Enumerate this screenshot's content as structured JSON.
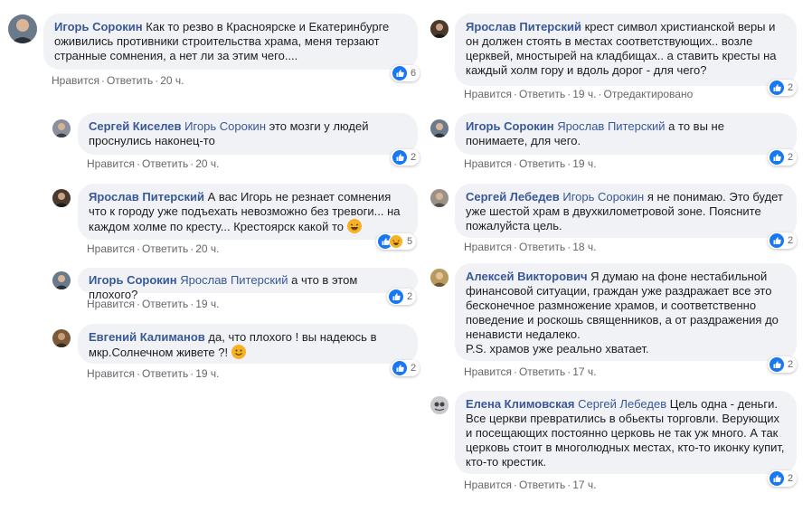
{
  "actions": {
    "like": "Нравится",
    "reply": "Ответить",
    "edited": "Отредактировано"
  },
  "left": [
    {
      "author": "Игорь Сорокин",
      "mention": "",
      "text": "Как то резво в Красноярске и Екатеринбурге оживились противники строительства храма, меня терзают странные сомнения, а нет ли за этим чего....",
      "time": "20 ч.",
      "reactions": "6"
    },
    {
      "author": "Сергей Киселев",
      "mention": "Игорь Сорокин",
      "text": "это мозги у людей проснулись наконец-то",
      "time": "20 ч.",
      "reactions": "2"
    },
    {
      "author": "Ярослав Питерский",
      "mention": "",
      "text": "А вас Игорь не резнает сомнения что к городу уже подъехать невозможно без тревоги... на каждом холме по кресту... Крестоярск какой то",
      "time": "20 ч.",
      "reactions": "5"
    },
    {
      "author": "Игорь Сорокин",
      "mention": "Ярослав Питерский",
      "text": "а что в этом плохого?",
      "time": "19 ч.",
      "reactions": "2"
    },
    {
      "author": "Евгений Калиманов",
      "mention": "",
      "text": "да, что плохого ! вы надеюсь в мкр.Солнечном живете ?!",
      "time": "19 ч.",
      "reactions": "2"
    }
  ],
  "right": [
    {
      "author": "Ярослав Питерский",
      "mention": "",
      "text": "крест символ христианской веры и он должен стоять в местах соответствующих.. возле церквей, мноcтырей на кладбищах.. а ставить кресты на каждый холм гору и вдоль дорог - для чего?",
      "time": "19 ч.",
      "reactions": "2"
    },
    {
      "author": "Игорь Сорокин",
      "mention": "Ярослав Питерский",
      "text": "а то вы не понимаете, для чего.",
      "time": "19 ч.",
      "reactions": "2"
    },
    {
      "author": "Сергей Лебедев",
      "mention": "Игорь Сорокин",
      "text": "я не понимаю. Это будет уже шестой храм в двухкилометровой зоне. Поясните пожалуйста цель.",
      "time": "18 ч.",
      "reactions": "2"
    },
    {
      "author": "Алексей Викторович",
      "mention": "",
      "text": "Я думаю на фоне нестабильной финансовой ситуации, граждан уже раздражает все это бесконечное размножение храмов, и соответственно поведение и роскошь священников, а от раздражения до ненависти недалеко.",
      "text2": "P.S. храмов уже реально хватает.",
      "time": "17 ч.",
      "reactions": "2"
    },
    {
      "author": "Елена Климовская",
      "mention": "Сергей Лебедев",
      "text": "Цель одна - деньги. Все церкви превратились в обьекты торговли. Верующих и посещающих постоянно церковь не так уж много. А так церковь стоит в многолюдных местах, кто-то иконку купит, кто-то крестик.",
      "time": "17 ч.",
      "reactions": "2"
    }
  ]
}
